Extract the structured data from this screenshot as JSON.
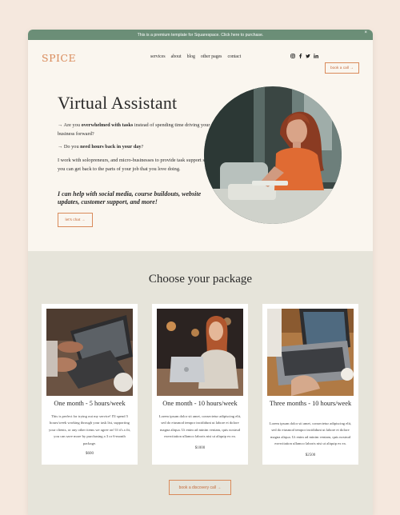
{
  "announcement": {
    "text": "This is a premium template for Squarespace. Click here to purchase.",
    "close": "×"
  },
  "nav": {
    "logo": "SPICE",
    "links": [
      "services",
      "about",
      "blog",
      "other pages",
      "contact"
    ],
    "social": [
      "instagram-icon",
      "facebook-icon",
      "twitter-icon",
      "linkedin-icon"
    ],
    "cta": "book a call →"
  },
  "hero": {
    "title": "Virtual Assistant",
    "line1_prefix": "→ Are you ",
    "line1_bold": "overwhelmed with tasks",
    "line1_suffix": " instead of spending time driving your business forward?",
    "line2_prefix": "→ Do you ",
    "line2_bold": "need hours back in your day",
    "line2_suffix": "?",
    "body": "I work with solopreneurs, and micro-businesses to provide task support so you can get back to the parts of your job that you love doing.",
    "emphasis": "I can help with social media, course buildouts, website updates, customer support, and more!",
    "cta": "let's chat →"
  },
  "packages": {
    "title": "Choose your package",
    "cards": [
      {
        "title": "One month - 5 hours/week",
        "desc": "This is perfect for trying out my service! I'll spend 5 hours/week working through your task list, supporting your clients, or any other items we agree on! If it's a fit, you can save more by purchasing a 3 or 6-month package.",
        "price": "$600"
      },
      {
        "title": "One month - 10 hours/week",
        "desc": "Lorem ipsum dolor sit amet, consectetur adipiscing elit, sed do eiusmod tempor incididunt ut labore et dolore magna aliqua. Ut enim ad minim veniam, quis nostrud exercitation ullamco laboris nisi ut aliquip ex ea.",
        "price": "$1000"
      },
      {
        "title": "Three months - 10 hours/week",
        "desc": "Lorem ipsum dolor sit amet, consectetur adipiscing elit, sed do eiusmod tempor incididunt ut labore et dolore magna aliqua. Ut enim ad minim veniam, quis nostrud exercitation ullamco laboris nisi ut aliquip ex ea.",
        "price": "$2500"
      }
    ],
    "cta": "book a discovery call →"
  },
  "colors": {
    "accent": "#d98a5a",
    "banner": "#6b8e77",
    "section": "#e6e4da",
    "background": "#f5e8de"
  }
}
